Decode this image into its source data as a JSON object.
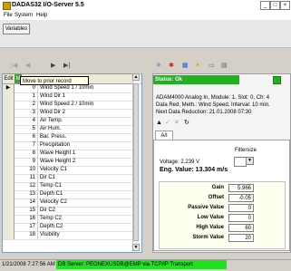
{
  "window": {
    "title": "DADAS32 I/O-Server 5.5",
    "minimize": "_",
    "maximize": "□",
    "close": "×"
  },
  "menu": [
    "File",
    "System",
    "Help"
  ],
  "variables_button": "Variables",
  "grid": {
    "header_edit": "Edit",
    "header_m": "M",
    "tooltip": "Move to prior record",
    "rows": [
      {
        "num": "0",
        "name": "Wind Speed 1 / 10min"
      },
      {
        "num": "1",
        "name": "Wind Dir 1"
      },
      {
        "num": "2",
        "name": "Wind Speed 2 / 10min"
      },
      {
        "num": "3",
        "name": "Wind Dir 2"
      },
      {
        "num": "4",
        "name": "Air Temp."
      },
      {
        "num": "5",
        "name": "Air Hum."
      },
      {
        "num": "6",
        "name": "Bar. Press."
      },
      {
        "num": "7",
        "name": "Precipitation"
      },
      {
        "num": "8",
        "name": "Wave Height 1"
      },
      {
        "num": "9",
        "name": "Wave Height 2"
      },
      {
        "num": "10",
        "name": "Velocity C1"
      },
      {
        "num": "11",
        "name": "Dir C1"
      },
      {
        "num": "12",
        "name": "Temp C1"
      },
      {
        "num": "13",
        "name": "Depth C1"
      },
      {
        "num": "14",
        "name": "Velocity C2"
      },
      {
        "num": "15",
        "name": "Dir C2"
      },
      {
        "num": "16",
        "name": "Temp C2"
      },
      {
        "num": "17",
        "name": "Depth C2"
      },
      {
        "num": "18",
        "name": "Visibility"
      }
    ]
  },
  "status": {
    "text": "Status: Ok",
    "line1": "ADAM4000 Analog In, Module: 1, Slot: 0, Ch: 4",
    "line2": "Data Red. Meth.: Wind Speed, Interval: 10 min.",
    "line3": "Next Data Reduction: 21.01.2008 07:30"
  },
  "tab": "A/I",
  "filter_label": "Filtersize",
  "voltage": "Voltage: 2.239 V",
  "eng_value": "Eng. Value: 13.304 m/s",
  "params": [
    {
      "label": "Gain",
      "value": "5.966"
    },
    {
      "label": "Offset",
      "value": "-0.05"
    },
    {
      "label": "Passive Value",
      "value": "0"
    },
    {
      "label": "Low Value",
      "value": "0"
    },
    {
      "label": "High Value",
      "value": "60"
    },
    {
      "label": "Storm Value",
      "value": "20"
    }
  ],
  "statusline": {
    "time": "1/21/2008 7:27:56 AM",
    "db": "DB Server: PEGNEXUSDB@EMP via TCP/IP Transport"
  }
}
